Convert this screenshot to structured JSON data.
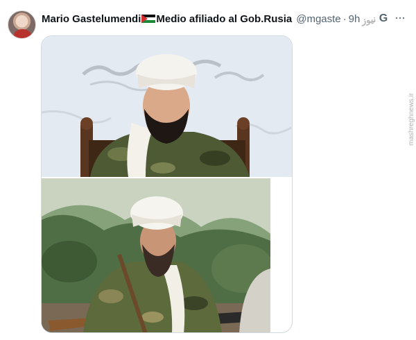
{
  "tweet": {
    "author_name": "Mario Gastelumendi",
    "flag_emoji": "palestine-flag",
    "author_suffix": "Medio afiliado al Gob.Rusia",
    "handle": "@mgaste",
    "separator": "·",
    "timestamp": "9h"
  },
  "icons": {
    "grok": "grok-icon",
    "more": "more-icon",
    "more_glyph": "···",
    "grok_glyph": "G"
  },
  "watermark": {
    "logo_text": "نیوز",
    "site": "mashreghnews.ir"
  },
  "media": {
    "images": [
      {
        "name": "photo-man-white-turban-camouflage-ornate-chair"
      },
      {
        "name": "photo-man-white-turban-camouflage-mountains"
      }
    ]
  },
  "colors": {
    "text_primary": "#0f1419",
    "text_secondary": "#536471",
    "border": "#cfd9de",
    "flag_black": "#111111",
    "flag_green": "#1a8a3a",
    "flag_red": "#d32f2f"
  }
}
